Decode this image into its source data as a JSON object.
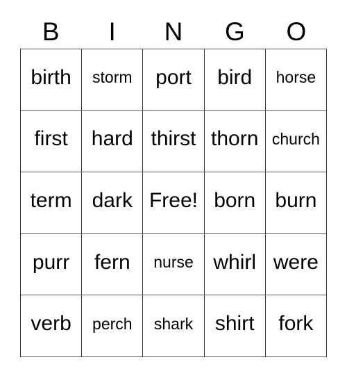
{
  "card": {
    "title": "BINGO",
    "header_letters": [
      "B",
      "I",
      "N",
      "G",
      "O"
    ],
    "free_space_label": "Free!",
    "colors": {
      "background": "#ffffff",
      "text": "#000000",
      "grid_line": "#333333"
    },
    "rows": [
      [
        {
          "text": "birth",
          "size": "normal"
        },
        {
          "text": "storm",
          "size": "small"
        },
        {
          "text": "port",
          "size": "normal"
        },
        {
          "text": "bird",
          "size": "normal"
        },
        {
          "text": "horse",
          "size": "small"
        }
      ],
      [
        {
          "text": "first",
          "size": "normal"
        },
        {
          "text": "hard",
          "size": "normal"
        },
        {
          "text": "thirst",
          "size": "normal"
        },
        {
          "text": "thorn",
          "size": "normal"
        },
        {
          "text": "church",
          "size": "small"
        }
      ],
      [
        {
          "text": "term",
          "size": "normal"
        },
        {
          "text": "dark",
          "size": "normal"
        },
        {
          "text": "Free!",
          "size": "normal"
        },
        {
          "text": "born",
          "size": "normal"
        },
        {
          "text": "burn",
          "size": "normal"
        }
      ],
      [
        {
          "text": "purr",
          "size": "normal"
        },
        {
          "text": "fern",
          "size": "normal"
        },
        {
          "text": "nurse",
          "size": "small"
        },
        {
          "text": "whirl",
          "size": "normal"
        },
        {
          "text": "were",
          "size": "normal"
        }
      ],
      [
        {
          "text": "verb",
          "size": "normal"
        },
        {
          "text": "perch",
          "size": "small"
        },
        {
          "text": "shark",
          "size": "small"
        },
        {
          "text": "shirt",
          "size": "normal"
        },
        {
          "text": "fork",
          "size": "normal"
        }
      ]
    ]
  }
}
